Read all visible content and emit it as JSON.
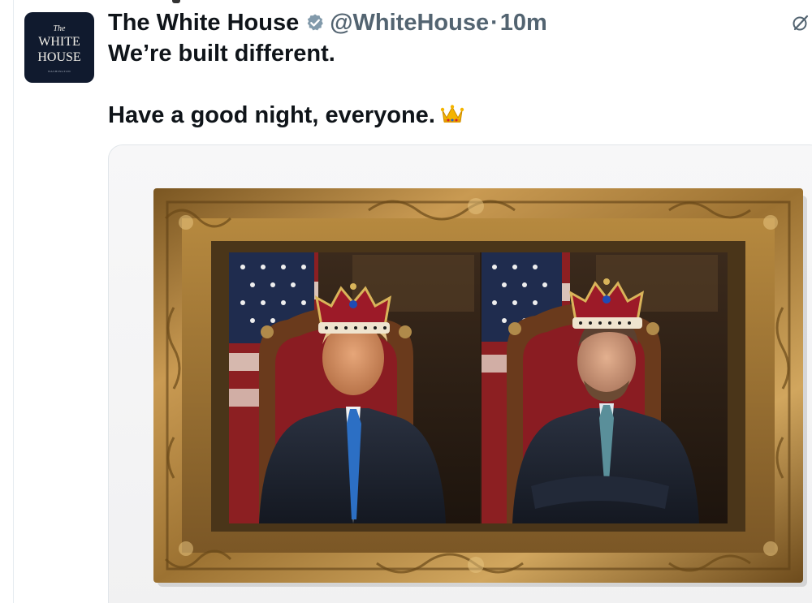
{
  "tweet": {
    "author": {
      "display_name": "The White House",
      "handle": "@WhiteHouse",
      "verified": true,
      "verified_color": "#829aab",
      "avatar": {
        "text_the": "The",
        "text_white": "WHITE",
        "text_house": "HOUSE",
        "text_sub": "WASHINGTON",
        "background": "#101a2e"
      }
    },
    "separator": "·",
    "time": "10m",
    "text_line1": "We’re built different.",
    "text_line2": "Have a good night, everyone.",
    "emoji": "crown",
    "icons": {
      "verified": "verified-badge-icon",
      "grok": "grok-icon",
      "emoji": "crown-emoji-icon"
    },
    "media": {
      "description_icon": "framed-portrait-image"
    }
  }
}
